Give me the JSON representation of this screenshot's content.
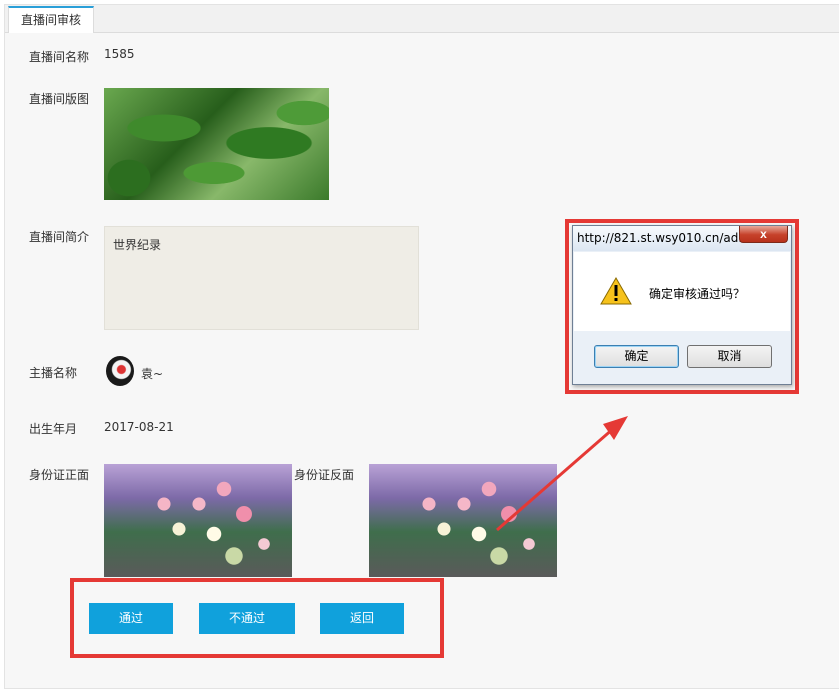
{
  "tab": {
    "label": "直播间审核"
  },
  "fields": {
    "room_name_label": "直播间名称",
    "room_name_value": "1585",
    "cover_label": "直播间版图",
    "intro_label": "直播间简介",
    "intro_value": "世界纪录",
    "anchor_label": "主播名称",
    "anchor_value": "袁~",
    "birth_label": "出生年月",
    "birth_value": "2017-08-21",
    "id_front_label": "身份证正面",
    "id_back_label": "身份证反面"
  },
  "actions": {
    "approve": "通过",
    "reject": "不通过",
    "back": "返回"
  },
  "dialog": {
    "title": "http://821.st.wsy010.cn/ad...",
    "close": "x",
    "message": "确定审核通过吗？",
    "ok": "确定",
    "cancel": "取消",
    "icon": "warning-icon"
  },
  "colors": {
    "primary_button": "#10a1dc",
    "annotation_red": "#e53935",
    "tab_accent": "#2a9fd8"
  }
}
